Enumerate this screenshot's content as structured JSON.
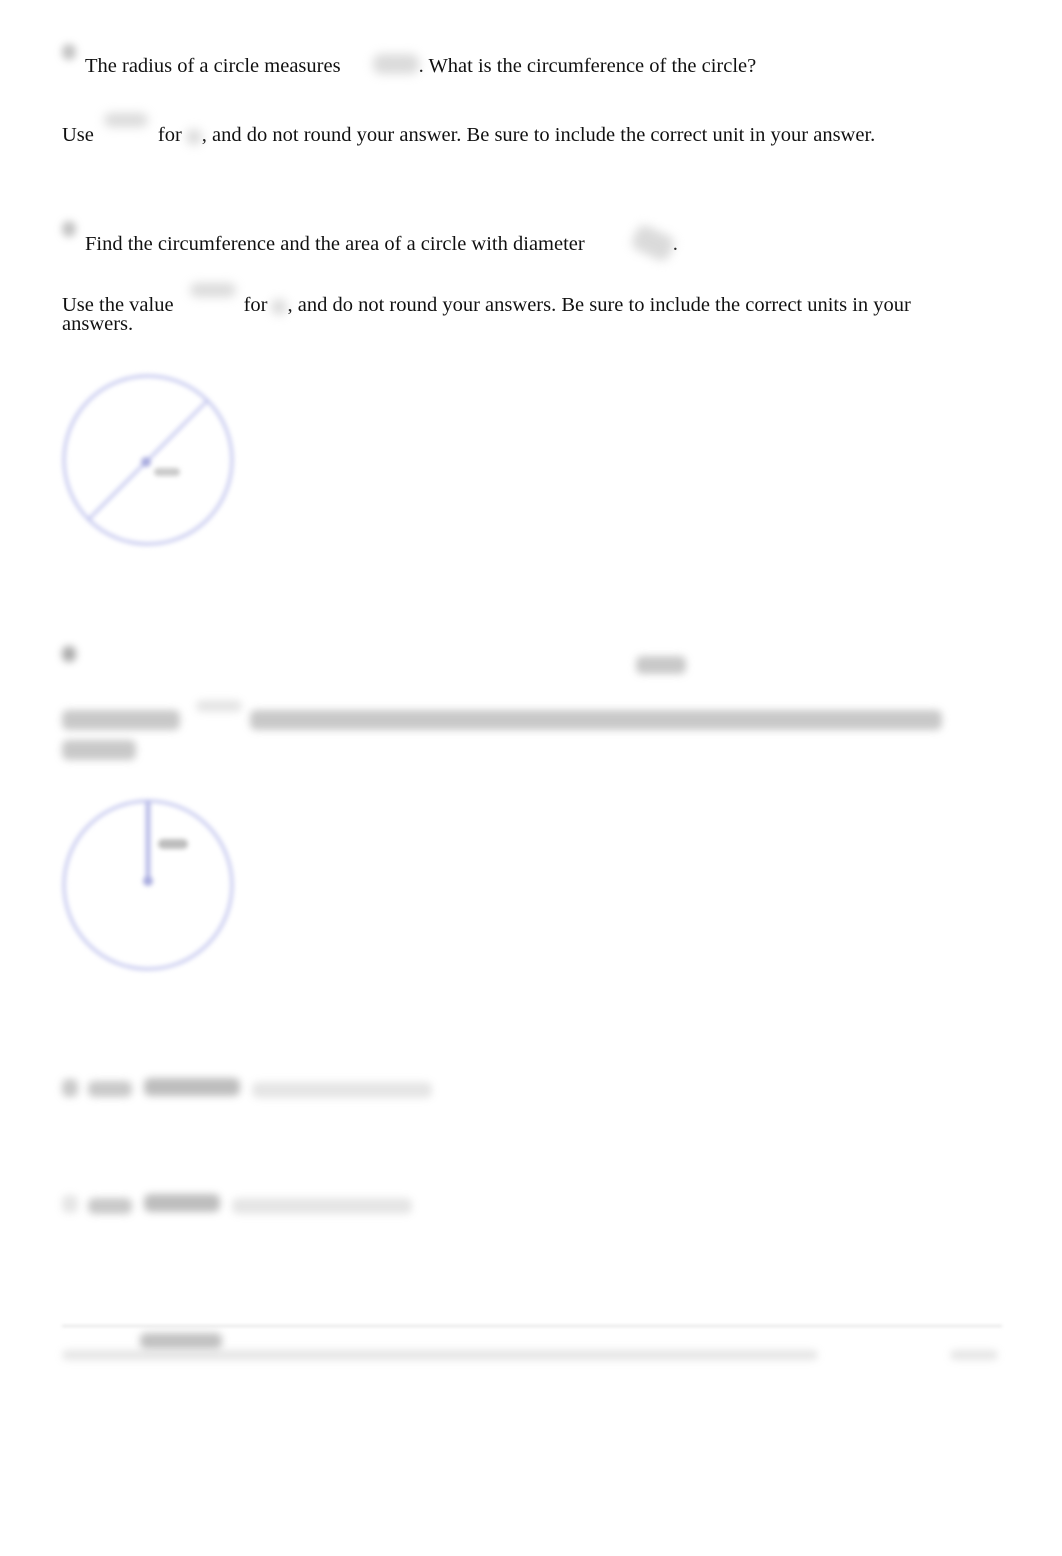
{
  "questions": [
    {
      "number_label": "",
      "prompt_parts": {
        "before": "The radius of a circle measures",
        "after": ". What is the circumference of the circle?"
      },
      "instruction_parts": {
        "before": "Use",
        "middle": "for",
        "after": ", and do not round your answer. Be sure to include the correct unit in your answer."
      }
    },
    {
      "number_label": "",
      "prompt_parts": {
        "before": "Find the circumference and the area of a circle with diameter",
        "after": "."
      },
      "instruction_parts": {
        "before": "Use the value",
        "middle": "for",
        "after": ", and do not round your answers. Be sure to include the correct units in your",
        "wrap": "answers."
      },
      "figure": {
        "type": "circle-with-diameter",
        "stroke_color": "#b9bde8"
      }
    },
    {
      "number_label": "",
      "figure": {
        "type": "circle-with-radius",
        "stroke_color": "#b9bde8"
      }
    }
  ],
  "answers": [
    {
      "label": ""
    },
    {
      "label": ""
    }
  ],
  "footer": {
    "text": "",
    "page": ""
  },
  "colors": {
    "text": "#111111",
    "figure_stroke": "#b9bde8",
    "redacted": "#bdbdbd"
  }
}
